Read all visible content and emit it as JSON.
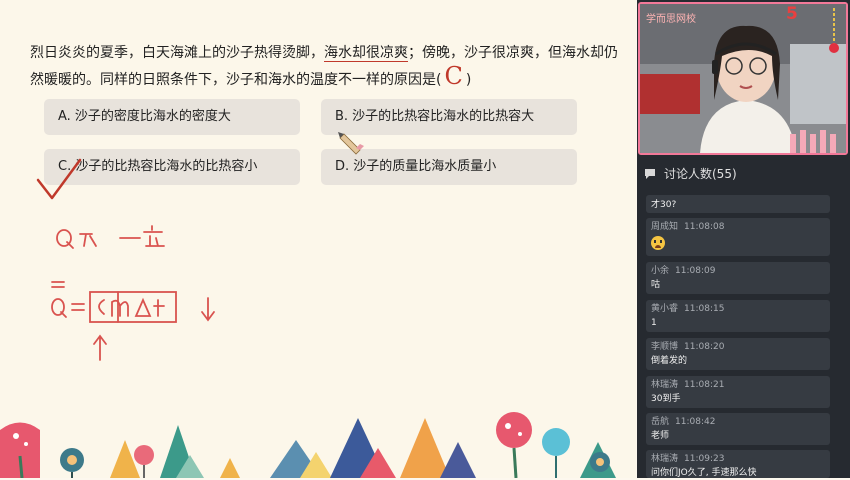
{
  "question": {
    "part1": "烈日炎炎的夏季，白天海滩上的沙子热得烫脚，",
    "highlight": "海水却很凉爽",
    "part2": "；傍晚，沙子很凉爽，但海水却仍然暖暖的。同样的日照条件下，沙子和海水的温度不一样的原因是(",
    "answer_mark": "C",
    "part3": ")"
  },
  "options": [
    {
      "id": "A",
      "text": "A.  沙子的密度比海水的密度大"
    },
    {
      "id": "B",
      "text": "B.  沙子的比热容比海水的比热容大"
    },
    {
      "id": "C",
      "text": "C.  沙子的比热容比海水的比热容小"
    },
    {
      "id": "D",
      "text": "D.  沙子的质量比海水质量小"
    }
  ],
  "camera": {
    "logo": "学而思网校",
    "number": "5"
  },
  "chat": {
    "title": "讨论人数(55)",
    "messages": [
      {
        "user": "",
        "time": "",
        "text": "才30?"
      },
      {
        "user": "周成知",
        "time": "11:08:08",
        "text": "",
        "emoji": "crying-face"
      },
      {
        "user": "小余",
        "time": "11:08:09",
        "text": "咕"
      },
      {
        "user": "黄小睿",
        "time": "11:08:15",
        "text": "1"
      },
      {
        "user": "李顺博",
        "time": "11:08:20",
        "text": "倒着发的"
      },
      {
        "user": "林瑞涛",
        "time": "11:08:21",
        "text": "30到手"
      },
      {
        "user": "岳航",
        "time": "11:08:42",
        "text": "老师"
      },
      {
        "user": "林瑞涛",
        "time": "11:09:23",
        "text": "问你们JO久了, 手速那么快"
      }
    ]
  },
  "colors": {
    "ink": "#c0392b",
    "panel": "#262a30",
    "bubble": "#363b42",
    "cam_border": "#f27999"
  }
}
